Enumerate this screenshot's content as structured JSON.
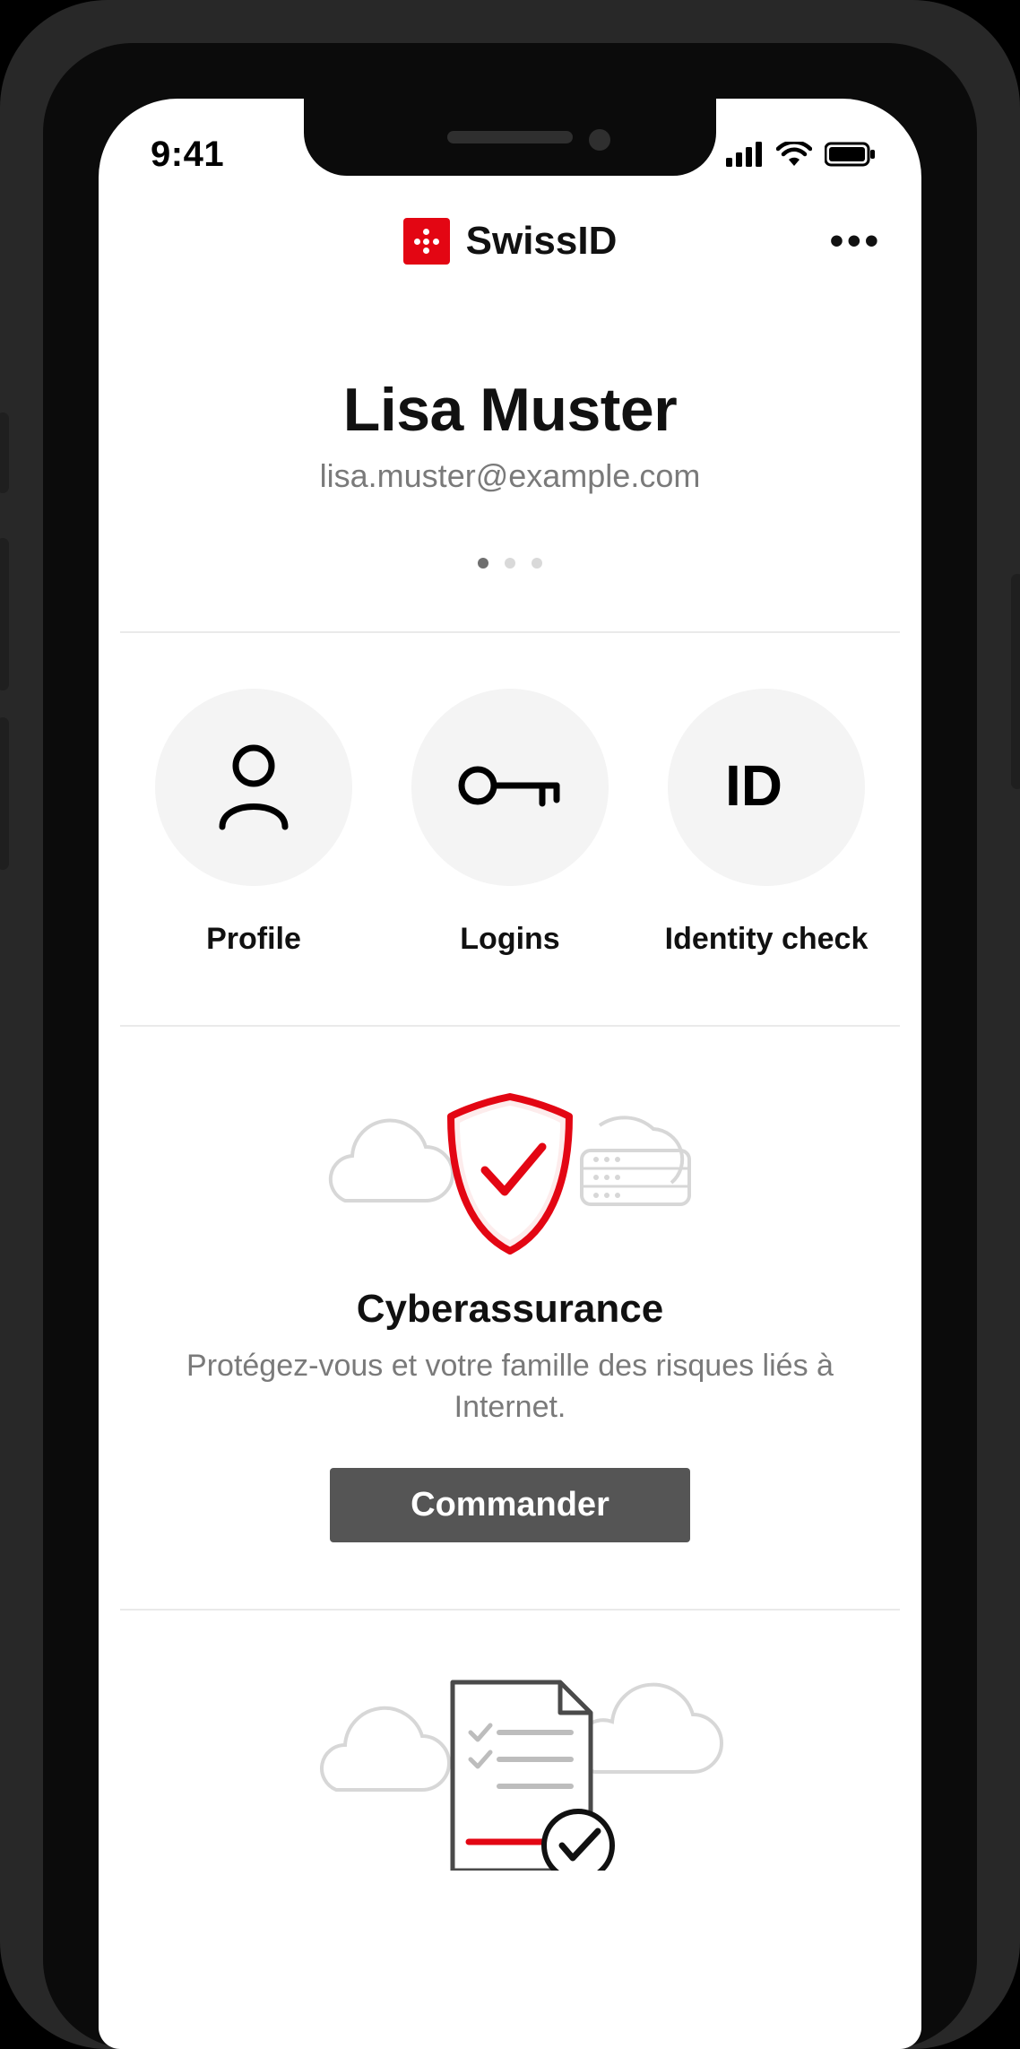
{
  "statusbar": {
    "time": "9:41"
  },
  "header": {
    "brand": "SwissID"
  },
  "user": {
    "name": "Lisa Muster",
    "email": "lisa.muster@example.com"
  },
  "carousel": {
    "count": 3,
    "active_index": 0
  },
  "actions": [
    {
      "icon": "person-icon",
      "label": "Profile"
    },
    {
      "icon": "key-icon",
      "label": "Logins"
    },
    {
      "icon": "id-icon",
      "label": "Identity check"
    }
  ],
  "promo": {
    "title": "Cyberassurance",
    "description": "Protégez-vous et votre famille des risques liés à Internet.",
    "cta": "Commander"
  },
  "colors": {
    "brand_red": "#e30613",
    "text_muted": "#7a7a7a",
    "circle_bg": "#f4f4f4",
    "button_bg": "#555555"
  }
}
